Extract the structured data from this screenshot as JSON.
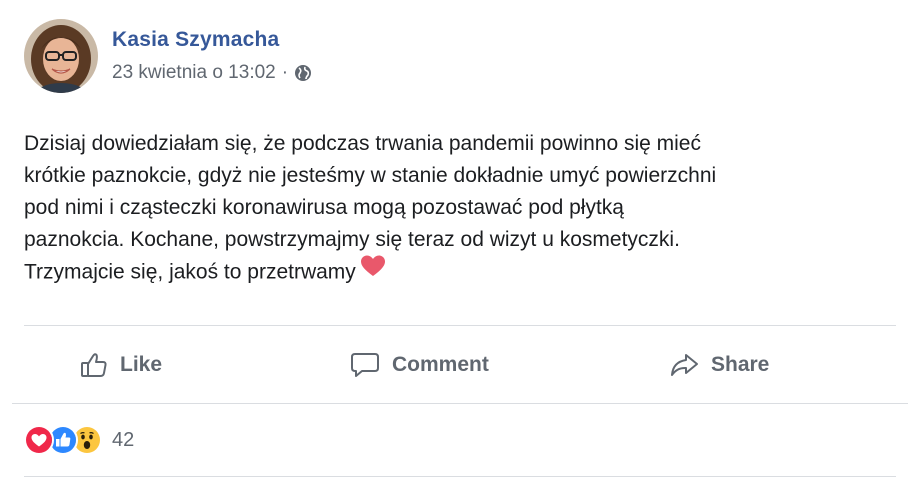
{
  "post": {
    "author": "Kasia Szymacha",
    "timestamp": "23 kwietnia o 13:02",
    "separator": "·",
    "privacy_icon": "globe-icon",
    "text_lines": [
      "Dzisiaj dowiedziałam się, że podczas trwania pandemii powinno się mieć",
      "krótkie paznokcie, gdyż nie jesteśmy w stanie dokładnie umyć powierzchni",
      "pod nimi i cząsteczki koronawirusa mogą pozostawać pod płytką",
      "paznokcia. Kochane, powstrzymajmy się teraz od wizyt u kosmetyczki.",
      "Trzymajcie się, jakoś to przetrwamy"
    ],
    "emoji": "heart-emoji"
  },
  "actions": {
    "like_label": "Like",
    "comment_label": "Comment",
    "share_label": "Share"
  },
  "reactions": {
    "icons": [
      "love-reaction-icon",
      "like-reaction-icon",
      "wow-reaction-icon"
    ],
    "count": "42"
  },
  "colors": {
    "author_link": "#365899",
    "secondary_text": "#606770",
    "body_text": "#1c1e21",
    "divider": "#dadde1",
    "love": "#f0284a",
    "like": "#2d88ff",
    "wow": "#fcc63f"
  }
}
